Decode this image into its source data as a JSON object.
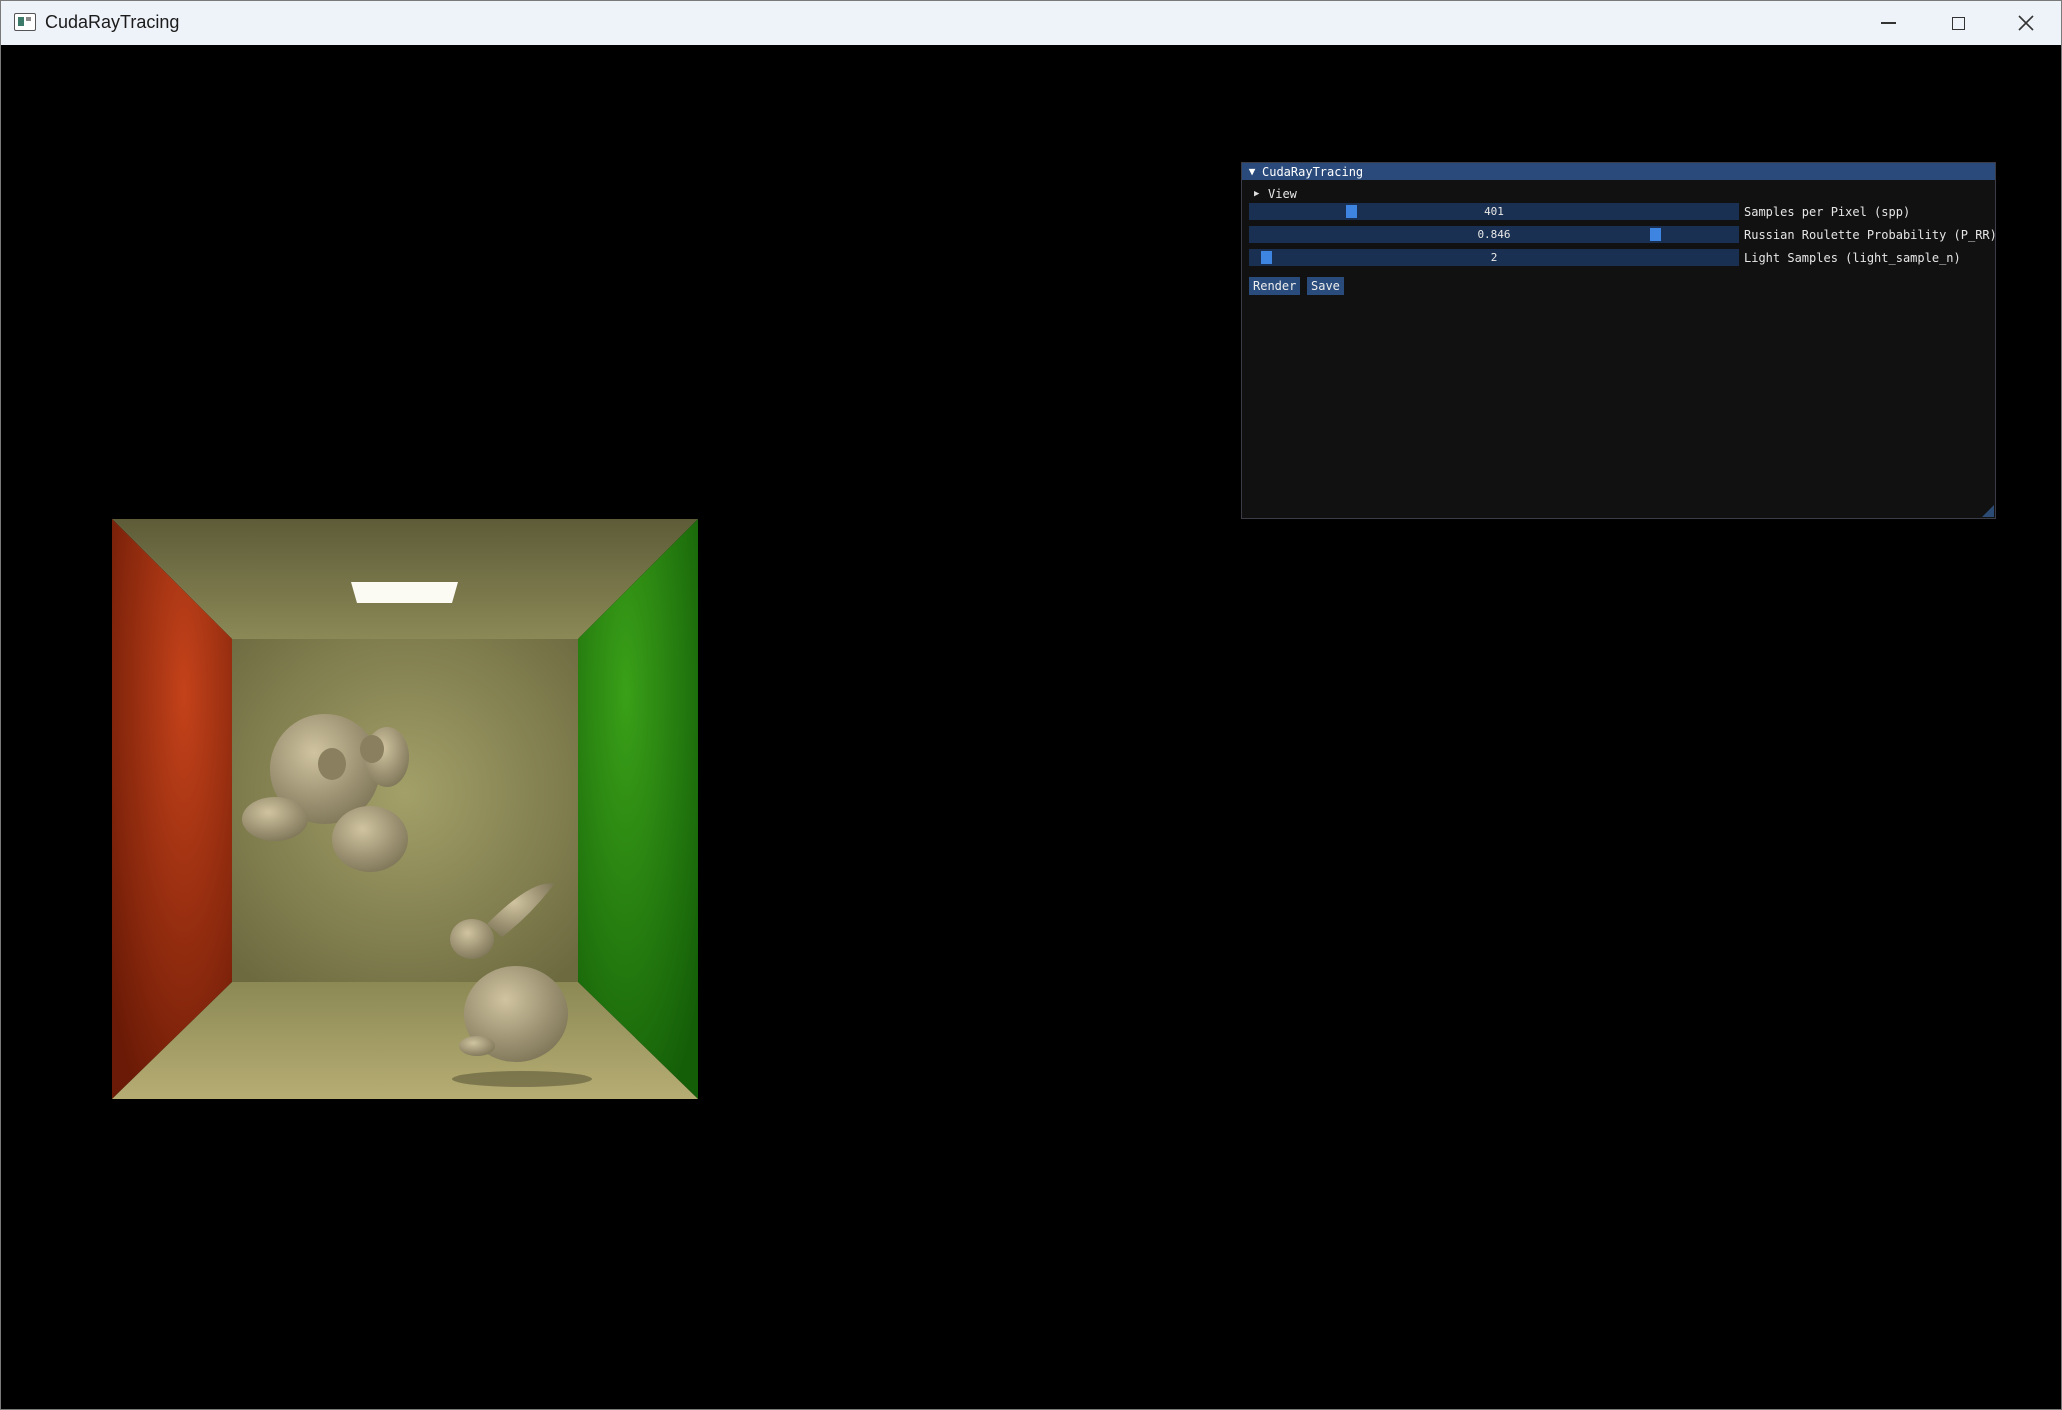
{
  "window": {
    "title": "CudaRayTracing"
  },
  "panel": {
    "title": "CudaRayTracing",
    "tree_view_label": "View",
    "sliders": [
      {
        "value": "401",
        "label": "Samples per Pixel (spp)",
        "fraction": 0.2
      },
      {
        "value": "0.846",
        "label": "Russian Roulette Probability (P_RR)",
        "fraction": 0.84
      },
      {
        "value": "2",
        "label": "Light Samples (light_sample_n)",
        "fraction": 0.02
      }
    ],
    "buttons": {
      "render": "Render",
      "save": "Save"
    }
  },
  "colors": {
    "title_bar_active": "#294a7a",
    "slider_bg": "#1a3052",
    "slider_grab": "#3d85e0",
    "button_bg": "#2a4c7c",
    "left_wall": "#b13a12",
    "right_wall": "#2a8a12"
  },
  "icons": {
    "app": "app-window-icon",
    "minimize": "minimize-icon",
    "maximize": "maximize-icon",
    "close": "close-icon",
    "collapse": "collapse-triangle-icon",
    "tree": "tree-arrow-icon"
  }
}
